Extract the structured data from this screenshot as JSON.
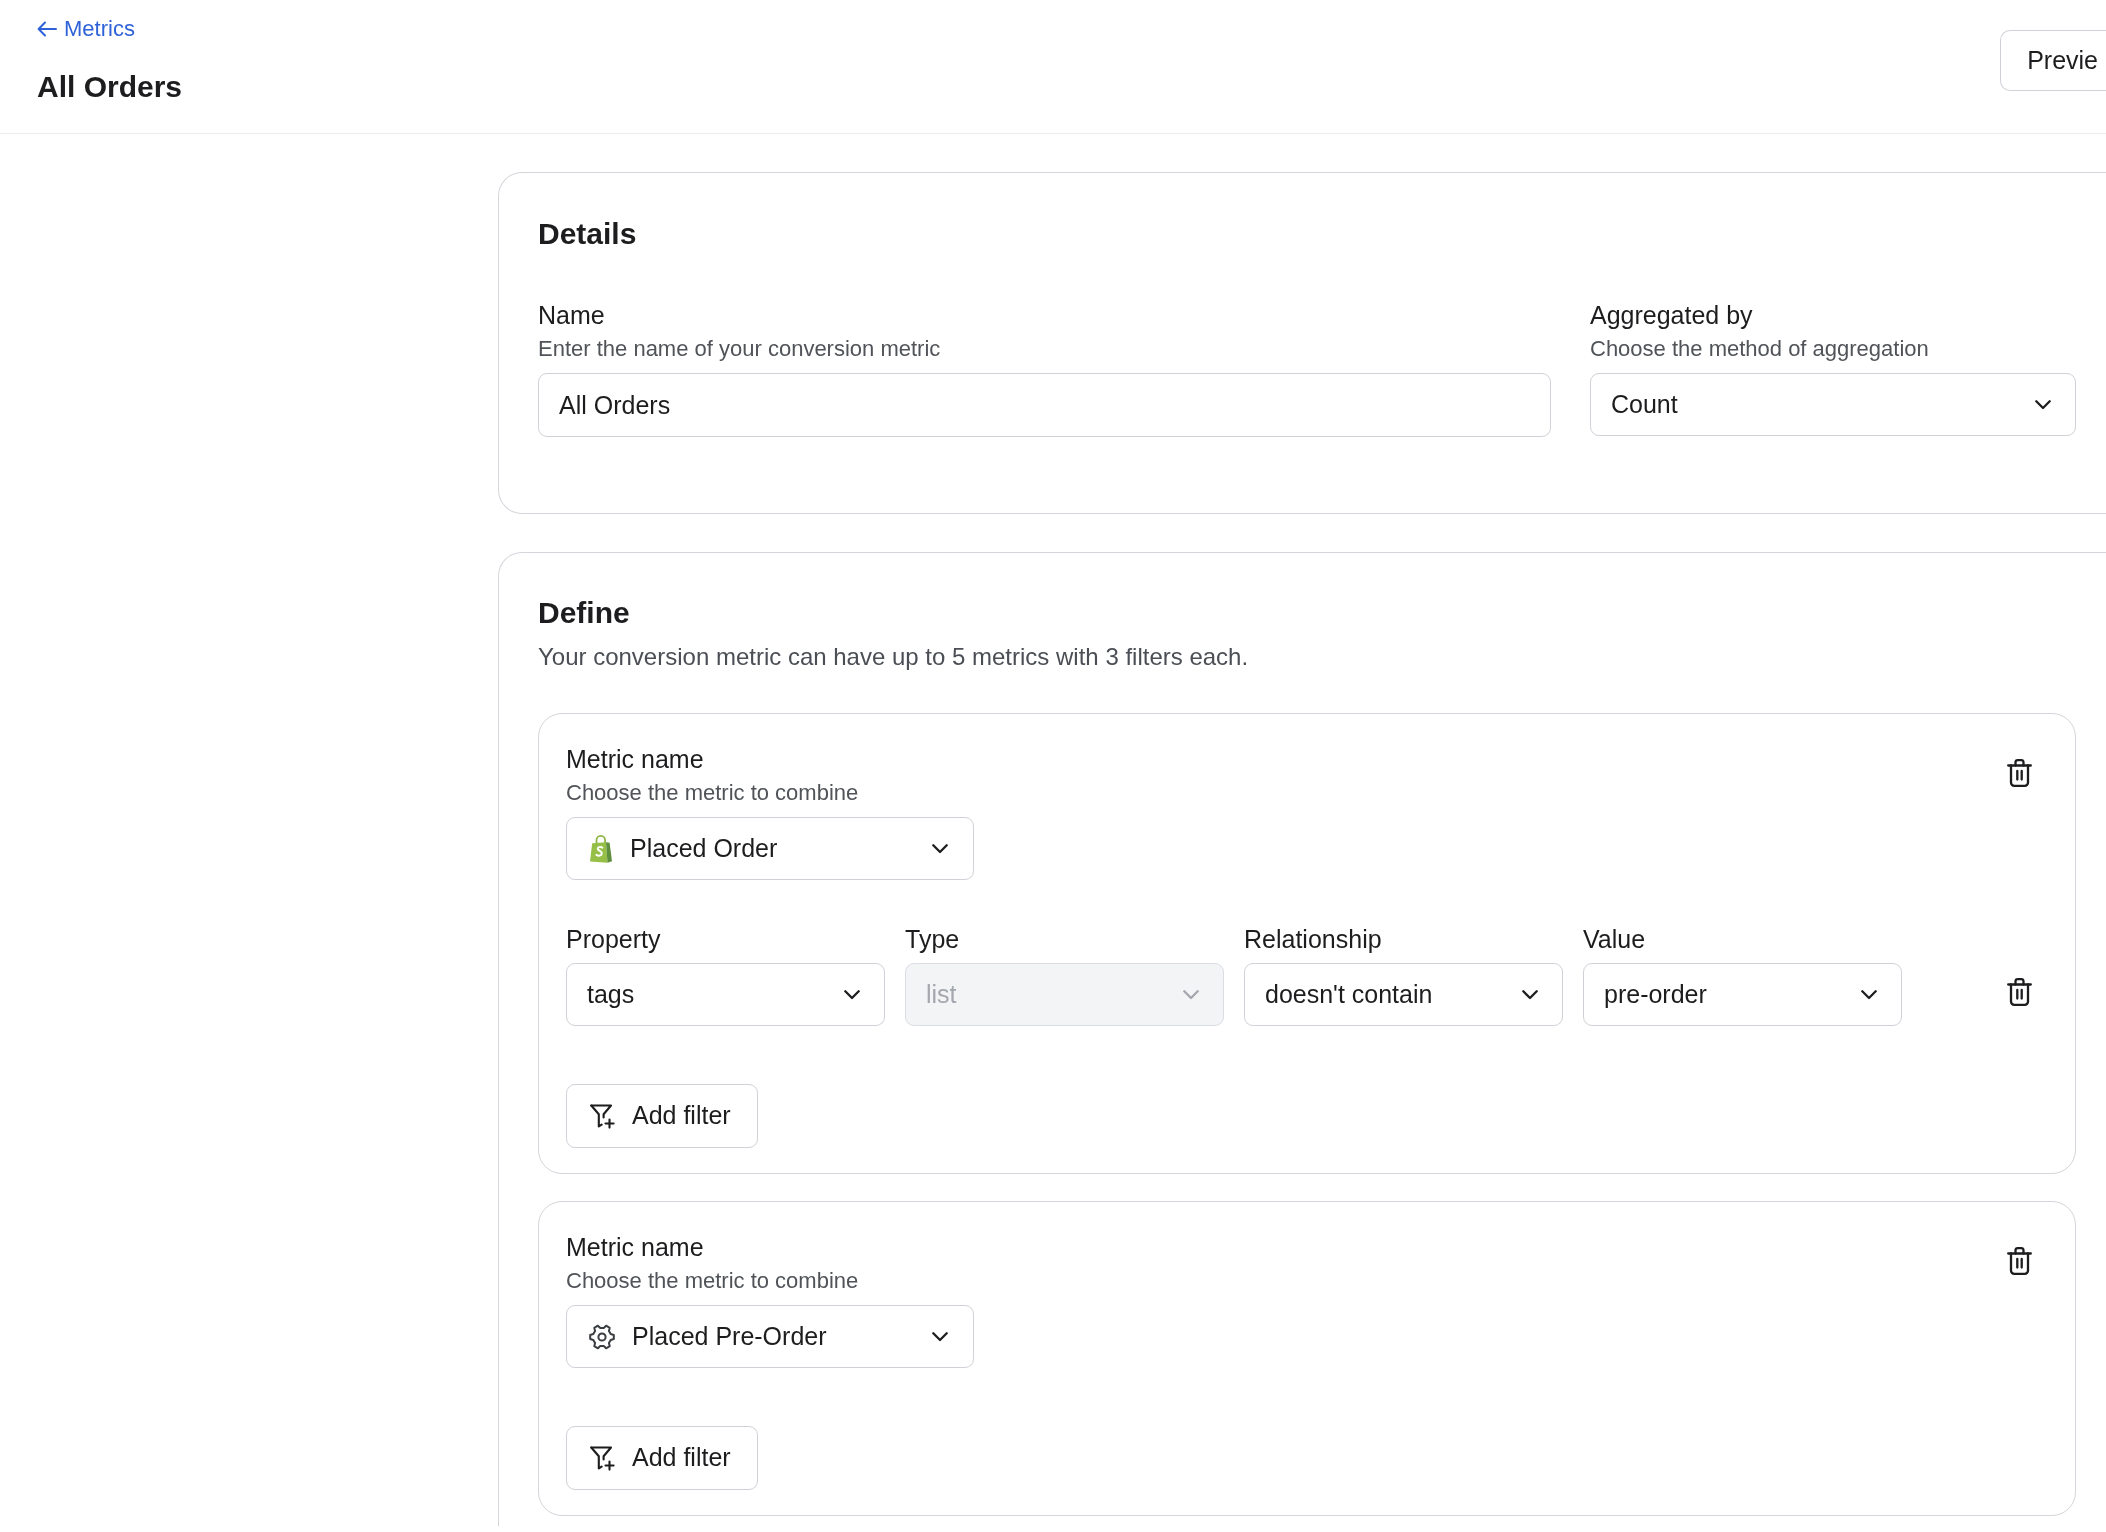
{
  "header": {
    "back_link": "Metrics",
    "title": "All Orders",
    "preview_button": "Previe"
  },
  "details": {
    "title": "Details",
    "fields": [
      {
        "kind": "input",
        "label": "Name",
        "help": "Enter the name of your conversion metric",
        "value": "All Orders"
      },
      {
        "kind": "select",
        "label": "Aggregated by",
        "help": "Choose the method of aggregation",
        "value": "Count"
      }
    ]
  },
  "define": {
    "title": "Define",
    "description": "Your conversion metric can have up to 5 metrics with 3 filters each.",
    "metrics": [
      {
        "label": "Metric name",
        "help": "Choose the metric to combine",
        "kind": "bag",
        "value": "Placed Order",
        "filters": [
          {
            "fields": [
              {
                "label": "Property",
                "value": "tags",
                "disabled": false
              },
              {
                "label": "Type",
                "value": "list",
                "disabled": true
              },
              {
                "label": "Relationship",
                "value": "doesn't contain",
                "disabled": false
              },
              {
                "label": "Value",
                "value": "pre-order",
                "disabled": false
              }
            ]
          }
        ],
        "add_filter": "Add filter"
      },
      {
        "label": "Metric name",
        "help": "Choose the metric to combine",
        "kind": "gear",
        "value": "Placed Pre-Order",
        "add_filter": "Add filter"
      }
    ]
  }
}
